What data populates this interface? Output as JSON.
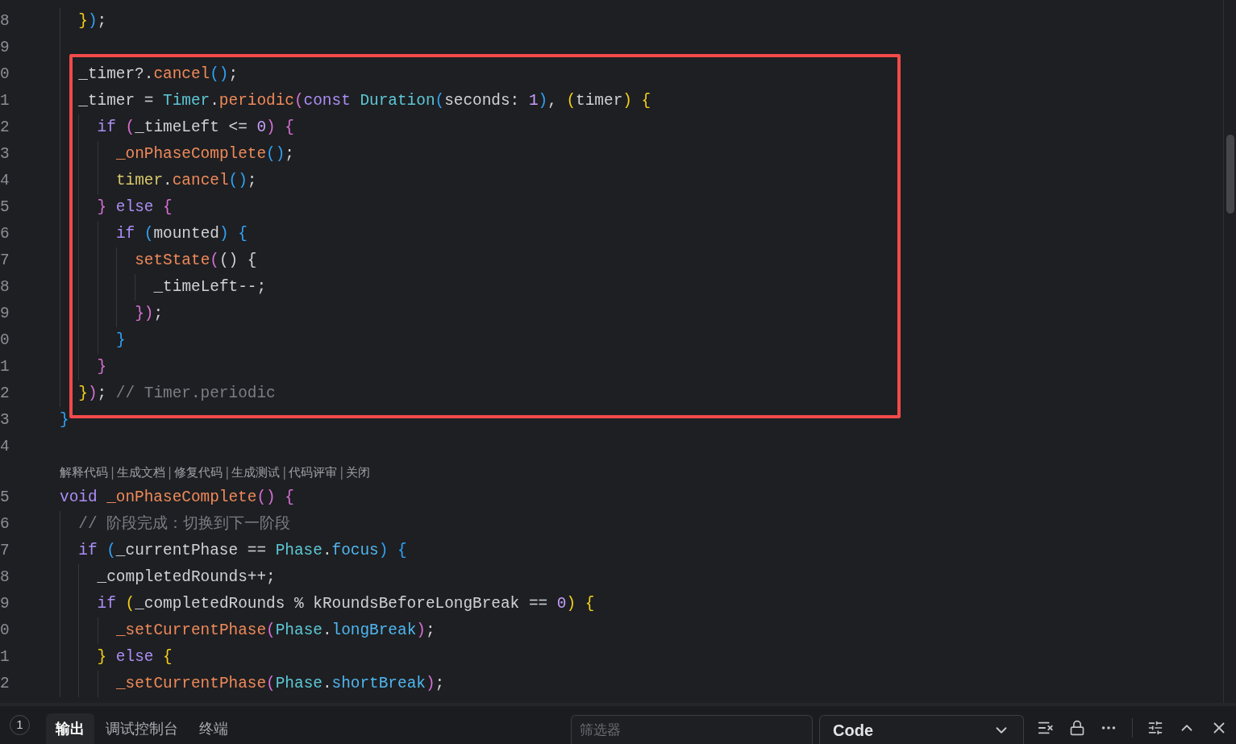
{
  "editor": {
    "lines": [
      {
        "children": [
          {
            "number": "8",
            "tokens": [
              {
                "text": "}",
                "kind": "brace1"
              },
              {
                "text": ")",
                "kind": "brace3"
              },
              {
                "text": ";",
                "kind": "plain"
              }
            ]
          },
          {
            "number": "9"
          },
          {
            "number": "0",
            "tokens": [
              {
                "text": "_timer?.",
                "kind": "plain"
              },
              {
                "text": "cancel",
                "kind": "function"
              },
              {
                "text": "()",
                "kind": "brace3"
              },
              {
                "text": ";",
                "kind": "plain"
              }
            ]
          },
          {
            "number": "1",
            "tokens": [
              {
                "text": "_timer = ",
                "kind": "plain"
              },
              {
                "text": "Timer",
                "kind": "type"
              },
              {
                "text": ".",
                "kind": "plain"
              },
              {
                "text": "periodic",
                "kind": "function"
              },
              {
                "text": "(",
                "kind": "brace2"
              },
              {
                "text": "const ",
                "kind": "keyword"
              },
              {
                "text": "Duration",
                "kind": "type"
              },
              {
                "text": "(",
                "kind": "brace3"
              },
              {
                "text": "seconds: ",
                "kind": "plain"
              },
              {
                "text": "1",
                "kind": "number"
              },
              {
                "text": ")",
                "kind": "brace3"
              },
              {
                "text": ", ",
                "kind": "plain"
              },
              {
                "text": "(",
                "kind": "brace1"
              },
              {
                "text": "timer",
                "kind": "plain"
              },
              {
                "text": ")",
                "kind": "brace1"
              },
              {
                "text": " {",
                "kind": "brace1"
              }
            ],
            "children": [
              {
                "number": "2",
                "tokens": [
                  {
                    "text": "if ",
                    "kind": "keyword"
                  },
                  {
                    "text": "(",
                    "kind": "brace2"
                  },
                  {
                    "text": "_timeLeft <= ",
                    "kind": "plain"
                  },
                  {
                    "text": "0",
                    "kind": "number"
                  },
                  {
                    "text": ")",
                    "kind": "brace2"
                  },
                  {
                    "text": " {",
                    "kind": "brace2"
                  }
                ],
                "children": [
                  {
                    "number": "3",
                    "tokens": [
                      {
                        "text": "_onPhaseComplete",
                        "kind": "function"
                      },
                      {
                        "text": "()",
                        "kind": "brace3"
                      },
                      {
                        "text": ";",
                        "kind": "plain"
                      }
                    ]
                  },
                  {
                    "number": "4",
                    "tokens": [
                      {
                        "text": "timer",
                        "kind": "param"
                      },
                      {
                        "text": ".",
                        "kind": "plain"
                      },
                      {
                        "text": "cancel",
                        "kind": "function"
                      },
                      {
                        "text": "()",
                        "kind": "brace3"
                      },
                      {
                        "text": ";",
                        "kind": "plain"
                      }
                    ]
                  }
                ]
              },
              {
                "number": "5",
                "tokens": [
                  {
                    "text": "}",
                    "kind": "brace2"
                  },
                  {
                    "text": " else ",
                    "kind": "keyword"
                  },
                  {
                    "text": "{",
                    "kind": "brace2"
                  }
                ],
                "children": [
                  {
                    "number": "6",
                    "tokens": [
                      {
                        "text": "if ",
                        "kind": "keyword"
                      },
                      {
                        "text": "(",
                        "kind": "brace3"
                      },
                      {
                        "text": "mounted",
                        "kind": "plain"
                      },
                      {
                        "text": ")",
                        "kind": "brace3"
                      },
                      {
                        "text": " {",
                        "kind": "brace3"
                      }
                    ],
                    "children": [
                      {
                        "number": "7",
                        "tokens": [
                          {
                            "text": "setState",
                            "kind": "function"
                          },
                          {
                            "text": "(",
                            "kind": "brace2"
                          },
                          {
                            "text": "() {",
                            "kind": "plain"
                          }
                        ],
                        "children": [
                          {
                            "number": "8",
                            "tokens": [
                              {
                                "text": "_timeLeft--;",
                                "kind": "plain"
                              }
                            ]
                          }
                        ]
                      },
                      {
                        "number": "9",
                        "tokens": [
                          {
                            "text": "}",
                            "kind": "brace2"
                          },
                          {
                            "text": ")",
                            "kind": "brace2"
                          },
                          {
                            "text": ";",
                            "kind": "plain"
                          }
                        ]
                      }
                    ]
                  },
                  {
                    "number": "0",
                    "tokens": [
                      {
                        "text": "}",
                        "kind": "brace3"
                      }
                    ]
                  }
                ]
              },
              {
                "number": "1",
                "tokens": [
                  {
                    "text": "}",
                    "kind": "brace2"
                  }
                ]
              }
            ]
          },
          {
            "number": "2",
            "tokens": [
              {
                "text": "}",
                "kind": "brace1"
              },
              {
                "text": ")",
                "kind": "brace2"
              },
              {
                "text": "; ",
                "kind": "plain"
              },
              {
                "text": "// Timer.periodic",
                "kind": "comment"
              }
            ]
          }
        ]
      },
      {
        "number": "3",
        "tokens": [
          {
            "text": "}",
            "kind": "brace3"
          }
        ]
      },
      {
        "number": "4"
      }
    ],
    "codelens": [
      {
        "kind": "action",
        "label": "解释代码"
      },
      {
        "kind": "separator",
        "label": "|"
      },
      {
        "kind": "action",
        "label": "生成文档"
      },
      {
        "kind": "separator",
        "label": "|"
      },
      {
        "kind": "action",
        "label": "修复代码"
      },
      {
        "kind": "separator",
        "label": "|"
      },
      {
        "kind": "action",
        "label": "生成测试"
      },
      {
        "kind": "separator",
        "label": "|"
      },
      {
        "kind": "action",
        "label": "代码评审"
      },
      {
        "kind": "separator",
        "label": "|"
      },
      {
        "kind": "action",
        "label": "关闭"
      }
    ],
    "lines_after": [
      {
        "number": "5",
        "tokens": [
          {
            "text": "void ",
            "kind": "keyword"
          },
          {
            "text": "_onPhaseComplete",
            "kind": "function"
          },
          {
            "text": "()",
            "kind": "brace2"
          },
          {
            "text": " {",
            "kind": "brace2"
          }
        ],
        "children": [
          {
            "number": "6",
            "tokens": [
              {
                "text": "// 阶段完成：切换到下一阶段",
                "kind": "comment"
              }
            ]
          },
          {
            "number": "7",
            "tokens": [
              {
                "text": "if ",
                "kind": "keyword"
              },
              {
                "text": "(",
                "kind": "brace3"
              },
              {
                "text": "_currentPhase == ",
                "kind": "plain"
              },
              {
                "text": "Phase",
                "kind": "type"
              },
              {
                "text": ".",
                "kind": "plain"
              },
              {
                "text": "focus",
                "kind": "property"
              },
              {
                "text": ")",
                "kind": "brace3"
              },
              {
                "text": " {",
                "kind": "brace3"
              }
            ],
            "children": [
              {
                "number": "8",
                "tokens": [
                  {
                    "text": "_completedRounds++;",
                    "kind": "plain"
                  }
                ]
              },
              {
                "number": "9",
                "tokens": [
                  {
                    "text": "if ",
                    "kind": "keyword"
                  },
                  {
                    "text": "(",
                    "kind": "brace1"
                  },
                  {
                    "text": "_completedRounds % kRoundsBeforeLongBreak == ",
                    "kind": "plain"
                  },
                  {
                    "text": "0",
                    "kind": "number"
                  },
                  {
                    "text": ")",
                    "kind": "brace1"
                  },
                  {
                    "text": " {",
                    "kind": "brace1"
                  }
                ],
                "children": [
                  {
                    "number": "0",
                    "tokens": [
                      {
                        "text": "_setCurrentPhase",
                        "kind": "function"
                      },
                      {
                        "text": "(",
                        "kind": "brace2"
                      },
                      {
                        "text": "Phase",
                        "kind": "type"
                      },
                      {
                        "text": ".",
                        "kind": "plain"
                      },
                      {
                        "text": "longBreak",
                        "kind": "property"
                      },
                      {
                        "text": ")",
                        "kind": "brace2"
                      },
                      {
                        "text": ";",
                        "kind": "plain"
                      }
                    ]
                  }
                ]
              },
              {
                "number": "1",
                "tokens": [
                  {
                    "text": "}",
                    "kind": "brace1"
                  },
                  {
                    "text": " else ",
                    "kind": "keyword"
                  },
                  {
                    "text": "{",
                    "kind": "brace1"
                  }
                ],
                "children": [
                  {
                    "number": "2",
                    "tokens": [
                      {
                        "text": "_setCurrentPhase",
                        "kind": "function"
                      },
                      {
                        "text": "(",
                        "kind": "brace2"
                      },
                      {
                        "text": "Phase",
                        "kind": "type"
                      },
                      {
                        "text": ".",
                        "kind": "plain"
                      },
                      {
                        "text": "shortBreak",
                        "kind": "property"
                      },
                      {
                        "text": ")",
                        "kind": "brace2"
                      },
                      {
                        "text": ";",
                        "kind": "plain"
                      }
                    ]
                  }
                ]
              }
            ]
          }
        ]
      }
    ]
  },
  "panel": {
    "badge": "1",
    "tabs": [
      {
        "label": "输出",
        "selected": true
      },
      {
        "label": "调试控制台",
        "selected": false
      },
      {
        "label": "终端",
        "selected": false
      }
    ],
    "filter": {
      "placeholder": "筛选器"
    },
    "channel": {
      "value": "Code"
    }
  }
}
